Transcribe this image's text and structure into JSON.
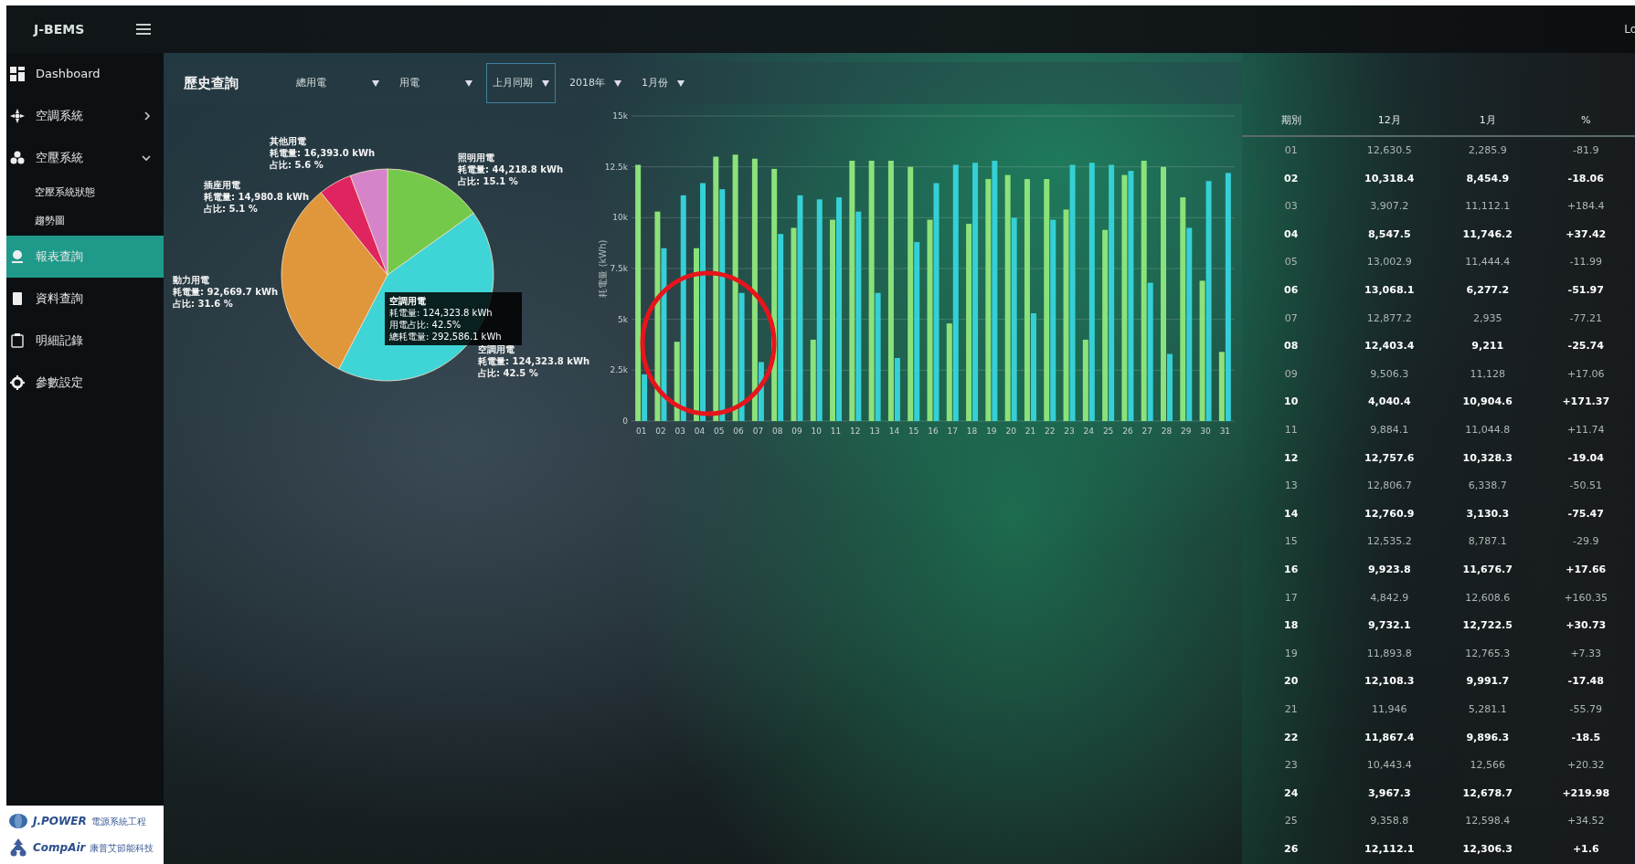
{
  "topbar": {
    "brand": "J-BEMS",
    "user_link": "Lo"
  },
  "sidebar": {
    "items": [
      {
        "label": "Dashboard",
        "selected": false
      },
      {
        "label": "空調系統",
        "selected": false,
        "expanded": false
      },
      {
        "label": "空壓系統",
        "selected": false,
        "expanded": true,
        "children": [
          {
            "label": "空壓系統狀態",
            "selected": false
          },
          {
            "label": "趨勢圖",
            "selected": false
          }
        ]
      },
      {
        "label": "報表查詢",
        "selected": true
      },
      {
        "label": "資料查詢",
        "selected": false
      },
      {
        "label": "明細記錄",
        "selected": false
      },
      {
        "label": "參數設定",
        "selected": false
      }
    ],
    "logos": [
      {
        "name": "J.POWER",
        "subtitle": "電源系統工程"
      },
      {
        "name": "CompAir",
        "subtitle": "康普艾節能科技"
      }
    ]
  },
  "page": {
    "title": "歷史查詢",
    "filters": [
      {
        "label": "總用電",
        "selected": false
      },
      {
        "label": "用電",
        "selected": false
      },
      {
        "label": "上月同期",
        "selected": true
      },
      {
        "label": "2018年",
        "selected": false
      },
      {
        "label": "1月份",
        "selected": false
      }
    ]
  },
  "pie": {
    "slices": [
      {
        "name": "照明用電",
        "amount": "耗電量: 44,218.8 kWh",
        "share": "占比: 15.1 %",
        "color": "#74c94a"
      },
      {
        "name": "空調用電",
        "amount": "耗電量: 124,323.8 kWh",
        "share": "占比: 42.5 %",
        "color": "#3fd4d6"
      },
      {
        "name": "動力用電",
        "amount": "耗電量: 92,669.7 kWh",
        "share": "占比: 31.6 %",
        "color": "#e0963a"
      },
      {
        "name": "插座用電",
        "amount": "耗電量: 14,980.8 kWh",
        "share": "占比: 5.1 %",
        "color": "#e0245f"
      },
      {
        "name": "其他用電",
        "amount": "耗電量: 16,393.0 kWh",
        "share": "占比: 5.6 %",
        "color": "#d684c9"
      }
    ],
    "tooltip": [
      "空調用電",
      "耗電量: 124,323.8 kWh",
      "用電占比: 42.5%",
      "總耗電量: 292,586.1 kWh"
    ],
    "chart_data": {
      "type": "pie",
      "values": [
        15.1,
        42.5,
        31.6,
        5.1,
        5.7
      ]
    }
  },
  "bar_chart": {
    "chart_data": {
      "type": "bar",
      "grid": true,
      "ylabel": "耗電量 (kWh)",
      "categories": [
        "01",
        "02",
        "03",
        "04",
        "05",
        "06",
        "07",
        "08",
        "09",
        "10",
        "11",
        "12",
        "13",
        "14",
        "15",
        "16",
        "17",
        "18",
        "19",
        "20",
        "21",
        "22",
        "23",
        "24",
        "25",
        "26",
        "27",
        "28",
        "29",
        "30",
        "31"
      ],
      "series": [
        {
          "color": "#8be27a",
          "values": [
            12600,
            10300,
            3900,
            8500,
            13000,
            13100,
            12900,
            12400,
            9500,
            4000,
            9900,
            12800,
            12800,
            12800,
            12500,
            9900,
            4800,
            9700,
            11900,
            12100,
            11900,
            11900,
            10400,
            4000,
            9400,
            12100,
            12800,
            12500,
            11000,
            6900,
            3400
          ]
        },
        {
          "color": "#35d0d6",
          "values": [
            2300,
            8500,
            11100,
            11700,
            11400,
            6300,
            2900,
            9200,
            11100,
            10900,
            11000,
            10300,
            6300,
            3100,
            8800,
            11700,
            12600,
            12700,
            12800,
            10000,
            5300,
            9900,
            12600,
            12700,
            12600,
            12300,
            6800,
            3300,
            9500,
            11800,
            12200
          ]
        }
      ],
      "ylim": [
        0,
        15000
      ],
      "yticks": [
        {
          "value": 0,
          "label": "0"
        },
        {
          "value": 2500,
          "label": "2.5k"
        },
        {
          "value": 5000,
          "label": "5k"
        },
        {
          "value": 7500,
          "label": "7.5k"
        },
        {
          "value": 10000,
          "label": "10k"
        },
        {
          "value": 12500,
          "label": "12.5k"
        },
        {
          "value": 15000,
          "label": "15k"
        }
      ]
    }
  },
  "table": {
    "columns": [
      "期別",
      "12月",
      "1月",
      "%"
    ],
    "rows": [
      [
        "01",
        "12,630.5",
        "2,285.9",
        "-81.9"
      ],
      [
        "02",
        "10,318.4",
        "8,454.9",
        "-18.06"
      ],
      [
        "03",
        "3,907.2",
        "11,112.1",
        "+184.4"
      ],
      [
        "04",
        "8,547.5",
        "11,746.2",
        "+37.42"
      ],
      [
        "05",
        "13,002.9",
        "11,444.4",
        "-11.99"
      ],
      [
        "06",
        "13,068.1",
        "6,277.2",
        "-51.97"
      ],
      [
        "07",
        "12,877.2",
        "2,935",
        "-77.21"
      ],
      [
        "08",
        "12,403.4",
        "9,211",
        "-25.74"
      ],
      [
        "09",
        "9,506.3",
        "11,128",
        "+17.06"
      ],
      [
        "10",
        "4,040.4",
        "10,904.6",
        "+171.37"
      ],
      [
        "11",
        "9,884.1",
        "11,044.8",
        "+11.74"
      ],
      [
        "12",
        "12,757.6",
        "10,328.3",
        "-19.04"
      ],
      [
        "13",
        "12,806.7",
        "6,338.7",
        "-50.51"
      ],
      [
        "14",
        "12,760.9",
        "3,130.3",
        "-75.47"
      ],
      [
        "15",
        "12,535.2",
        "8,787.1",
        "-29.9"
      ],
      [
        "16",
        "9,923.8",
        "11,676.7",
        "+17.66"
      ],
      [
        "17",
        "4,842.9",
        "12,608.6",
        "+160.35"
      ],
      [
        "18",
        "9,732.1",
        "12,722.5",
        "+30.73"
      ],
      [
        "19",
        "11,893.8",
        "12,765.3",
        "+7.33"
      ],
      [
        "20",
        "12,108.3",
        "9,991.7",
        "-17.48"
      ],
      [
        "21",
        "11,946",
        "5,281.1",
        "-55.79"
      ],
      [
        "22",
        "11,867.4",
        "9,896.3",
        "-18.5"
      ],
      [
        "23",
        "10,443.4",
        "12,566",
        "+20.32"
      ],
      [
        "24",
        "3,967.3",
        "12,678.7",
        "+219.98"
      ],
      [
        "25",
        "9,358.8",
        "12,598.4",
        "+34.52"
      ],
      [
        "26",
        "12,112.1",
        "12,306.3",
        "+1.6"
      ]
    ]
  },
  "annotations": [
    {
      "kind": "circle"
    }
  ]
}
